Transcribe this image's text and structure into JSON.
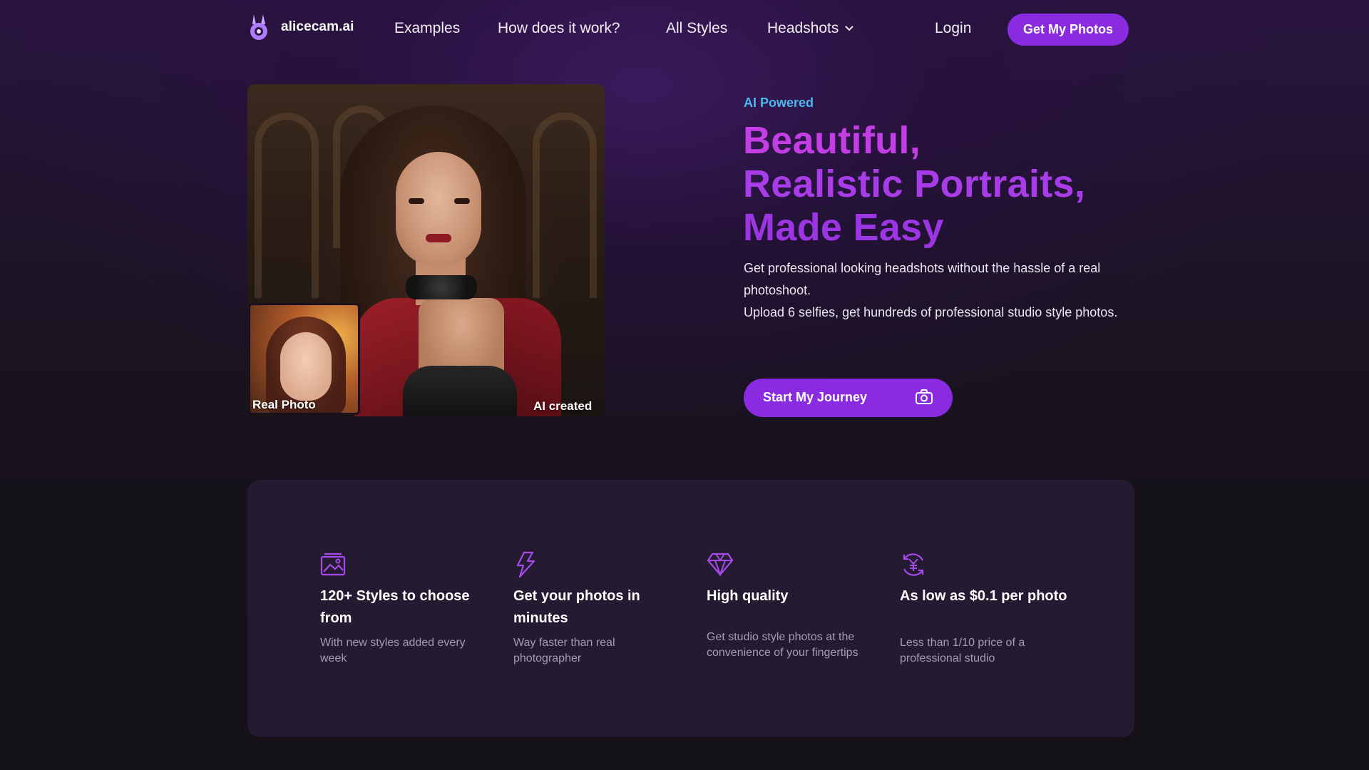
{
  "nav": {
    "brand": "alicecam.ai",
    "links": [
      "Examples",
      "How does it work?",
      "All Styles",
      "Headshots"
    ],
    "login": "Login",
    "cta": "Get My Photos"
  },
  "hero": {
    "image": {
      "real_label": "Real Photo",
      "ai_label": "AI created"
    },
    "eyebrow": "AI Powered",
    "headline": [
      "Beautiful,",
      "Realistic Portraits,",
      "Made Easy"
    ],
    "description_1": "Get professional looking headshots without the hassle of a real photoshoot.",
    "description_2": "Upload 6 selfies, get hundreds of professional studio style photos.",
    "cta": "Start My Journey",
    "cta_icon": "camera-icon"
  },
  "features": [
    {
      "icon": "image-gallery-icon",
      "title": "120+ Styles to choose from",
      "desc": "With new styles added every week"
    },
    {
      "icon": "lightning-icon",
      "title": "Get your photos in minutes",
      "desc": "Way faster than real photographer"
    },
    {
      "icon": "diamond-icon",
      "title": "High quality",
      "desc": "Get studio style photos at the convenience of your fingertips"
    },
    {
      "icon": "yen-refresh-icon",
      "title": "As low as $0.1 per photo",
      "desc": "Less than 1/10 price of a professional studio"
    }
  ],
  "colors": {
    "accent": "#8a2be2",
    "headline_gradient_start": "#c43ee6",
    "headline_gradient_end": "#9c35e3",
    "eyebrow": "#4fb6ef",
    "feature_card": "#241a31"
  }
}
